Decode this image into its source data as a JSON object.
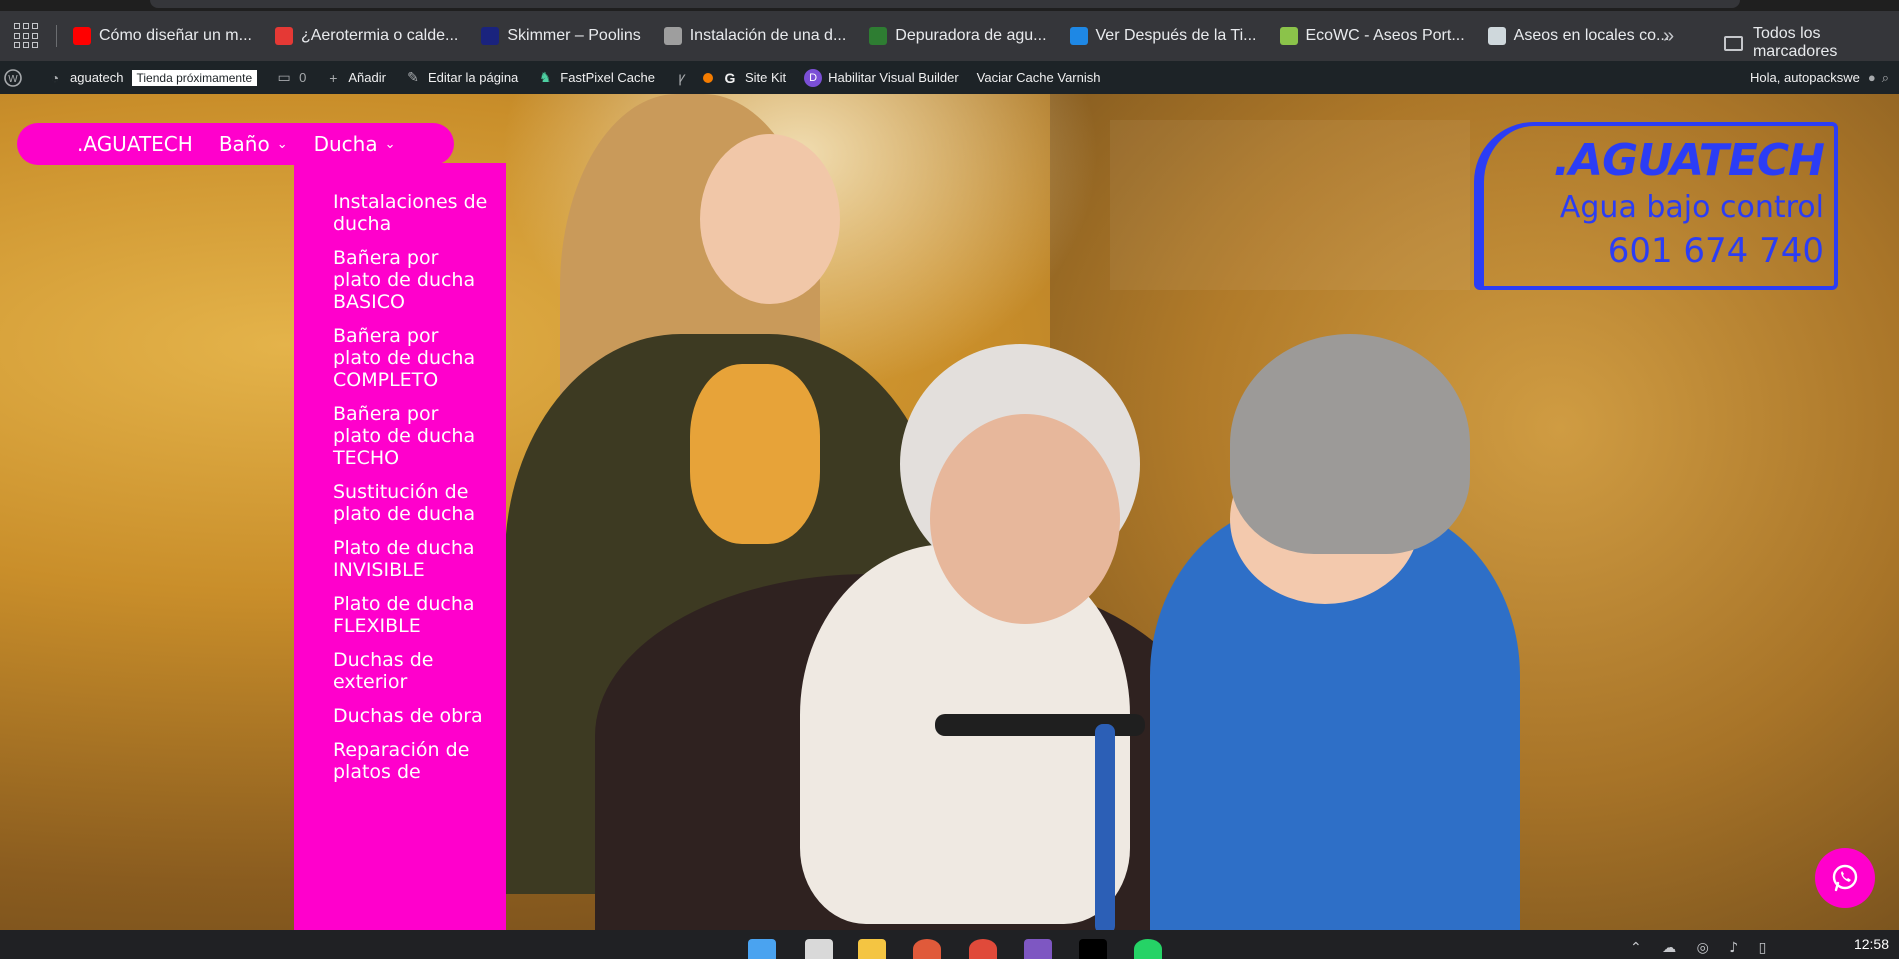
{
  "bookmarks": {
    "items": [
      {
        "label": "Cómo diseñar un m...",
        "icon": "youtube-icon",
        "color": "#ff0000"
      },
      {
        "label": "¿Aerotermia o calde...",
        "icon": "moon-logo-icon",
        "color": "#e53935"
      },
      {
        "label": "Skimmer – Poolins",
        "icon": "poolins-icon",
        "color": "#1a237e"
      },
      {
        "label": "Instalación de una d...",
        "icon": "globe-icon",
        "color": "#9e9e9e"
      },
      {
        "label": "Depuradora de agu...",
        "icon": "image-icon",
        "color": "#2e7d32"
      },
      {
        "label": "Ver Después de la Ti...",
        "icon": "edge-icon",
        "color": "#1e88e5"
      },
      {
        "label": "EcoWC - Aseos Port...",
        "icon": "ecowc-icon",
        "color": "#8bc34a"
      },
      {
        "label": "Aseos en locales co...",
        "icon": "shell-icon",
        "color": "#cfd8dc"
      }
    ],
    "more": "»",
    "all_label": "Todos los marcadores"
  },
  "adminbar": {
    "site": "aguatech",
    "badge": "Tienda próximamente",
    "comments": "0",
    "add": "Añadir",
    "edit": "Editar la página",
    "fastpixel": "FastPixel Cache",
    "sitekit": "Site Kit",
    "divi": "Habilitar Visual Builder",
    "varnish": "Vaciar Cache Varnish",
    "greeting": "Hola, autopackswe"
  },
  "nav": {
    "home": ".AGUATECH",
    "bano": "Baño",
    "ducha": "Ducha"
  },
  "dropdown": [
    "Instalaciones de ducha",
    "Bañera por plato de ducha BASICO",
    "Bañera por plato de ducha COMPLETO",
    "Bañera por plato de ducha TECHO",
    "Sustitución de plato de ducha",
    "Plato de ducha INVISIBLE",
    "Plato de ducha FLEXIBLE",
    "Duchas de exterior",
    "Duchas de obra",
    "Reparación de platos de"
  ],
  "logo": {
    "brand": ".AGUATECH",
    "tagline": "Agua bajo control",
    "phone": "601 674 740"
  },
  "taskbar": {
    "time": "12:58"
  },
  "colors": {
    "accent": "#ff00cc",
    "brand_blue": "#2b3df5",
    "adminbar": "#1d2327"
  }
}
